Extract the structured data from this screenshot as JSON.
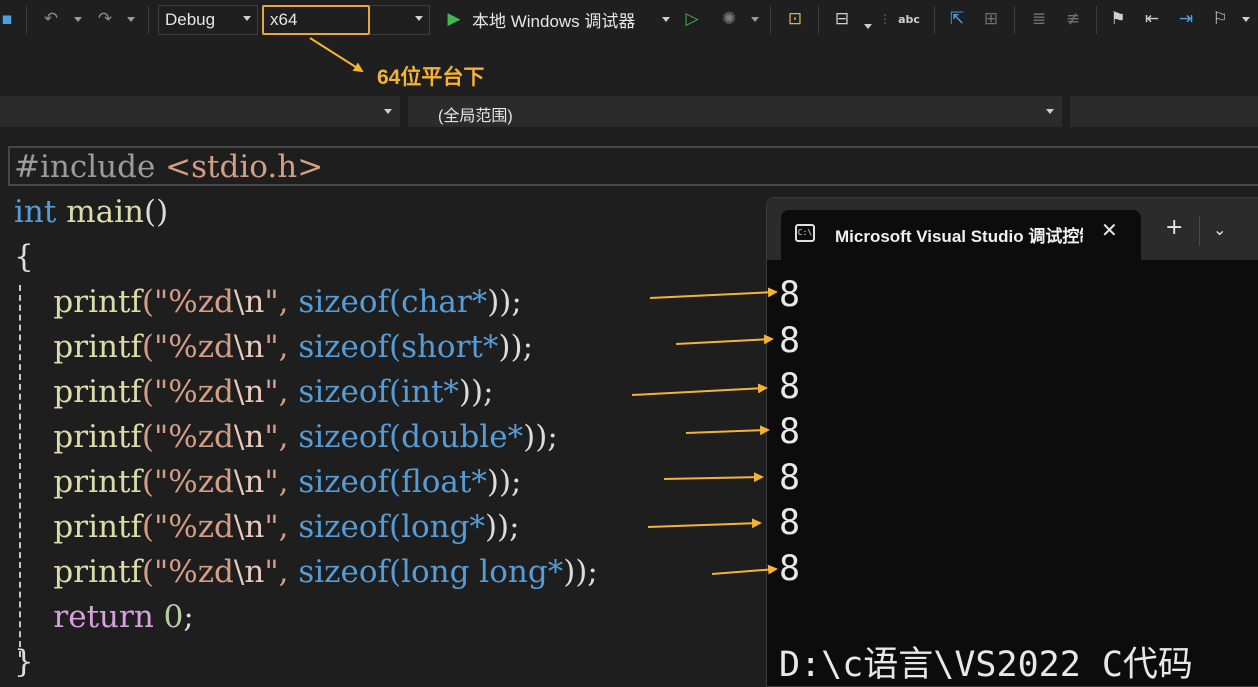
{
  "toolbar": {
    "configuration": "Debug",
    "platform": "x64",
    "run_label": "本地 Windows 调试器"
  },
  "annotation": {
    "text": "64位平台下"
  },
  "navbar": {
    "scope": "(全局范围)"
  },
  "code": {
    "include": "#include",
    "header": "<stdio.h>",
    "int_kw": "int",
    "main": "main",
    "parens": "()",
    "open_brace": "{",
    "close_brace": "}",
    "printf": "printf",
    "fmt_open": "(\"%zd",
    "fmt_esc": "\\n",
    "fmt_close": "\",",
    "sizeof": "sizeof",
    "types": [
      "char*",
      "short*",
      "int*",
      "double*",
      "float*",
      "long*",
      "long long*"
    ],
    "line_end": "));",
    "return_kw": "return",
    "zero": "0",
    "semicolon": ";"
  },
  "console": {
    "title": "Microsoft Visual Studio 调试控制台",
    "icon_text": "C:\\",
    "outputs": [
      "8",
      "8",
      "8",
      "8",
      "8",
      "8",
      "8"
    ],
    "path": "D:\\c语言\\VS2022 C代码"
  },
  "colors": {
    "accent": "#f5b335",
    "keyword": "#569cd6",
    "function": "#dcdcaa",
    "string": "#d69d85",
    "run_green": "#3fb950"
  }
}
